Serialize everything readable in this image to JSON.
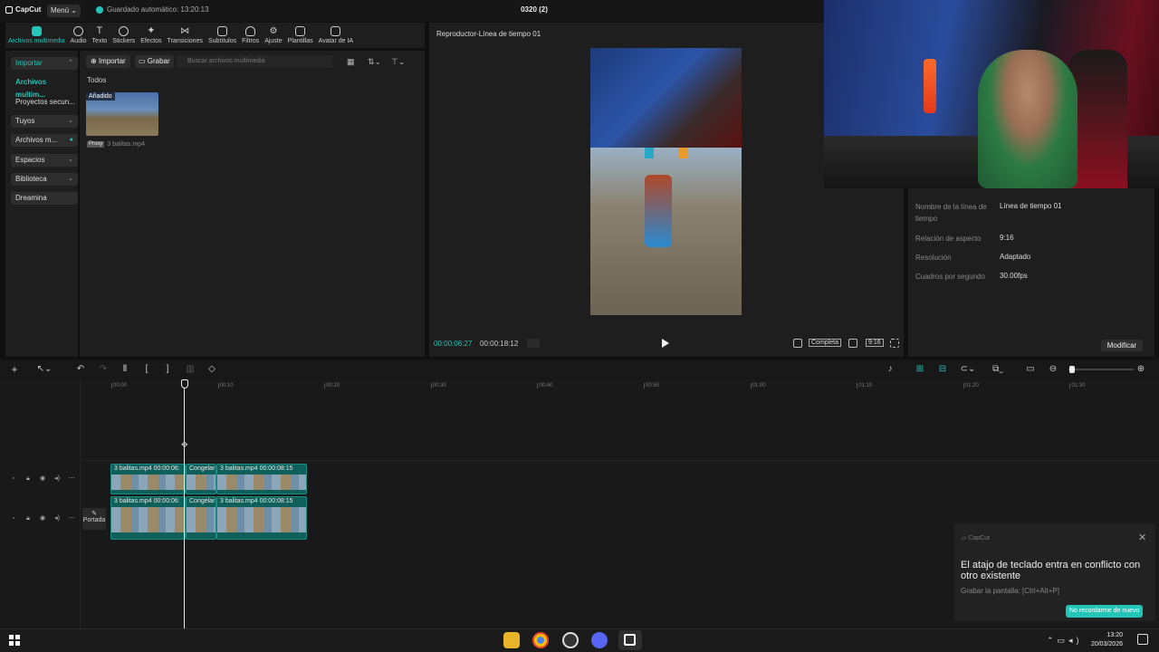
{
  "app": {
    "logo": "CapCut",
    "menu_label": "Menú ⌄",
    "autosave": "Guardado automático: 13:20:13",
    "project_title": "0320 (2)"
  },
  "tabs": [
    {
      "label": "Archivos multimedia",
      "icon": "media-icon",
      "active": true
    },
    {
      "label": "Audio",
      "icon": "audio-icon"
    },
    {
      "label": "Texto",
      "icon": "text-icon"
    },
    {
      "label": "Stickers",
      "icon": "sticker-icon"
    },
    {
      "label": "Efectos",
      "icon": "effects-icon"
    },
    {
      "label": "Transiciones",
      "icon": "transitions-icon"
    },
    {
      "label": "Subtítulos",
      "icon": "subtitles-icon"
    },
    {
      "label": "Filtros",
      "icon": "filters-icon"
    },
    {
      "label": "Ajuste",
      "icon": "adjust-icon"
    },
    {
      "label": "Plantillas",
      "icon": "templates-icon"
    },
    {
      "label": "Avatar de IA",
      "icon": "ai-avatar-icon"
    }
  ],
  "sidebar": {
    "items": [
      {
        "label": "Importar"
      },
      {
        "label": "Archivos multim..."
      },
      {
        "label": "Proyectos secun..."
      },
      {
        "label": "Tuyos"
      },
      {
        "label": "Archivos m..."
      },
      {
        "label": "Espacios"
      },
      {
        "label": "Biblioteca"
      },
      {
        "label": "Dreamina"
      }
    ]
  },
  "media": {
    "import_label": "Importar",
    "record_label": "Grabar",
    "search_placeholder": "Buscar archivos multimedia",
    "section_label": "Todos",
    "item": {
      "badge": "Añadido",
      "proxy": "Proxy",
      "name": "3 balitas.mp4"
    }
  },
  "player": {
    "title": "Reproductor-Línea de tiempo 01",
    "current_time": "00:00:06:27",
    "total_time": "00:00:18:12",
    "complete_label": "Completa",
    "ratio_label": "9:16"
  },
  "details": {
    "rows": [
      {
        "key": "Nombre de la línea de tiempo",
        "value": "Línea de tiempo 01"
      },
      {
        "key": "Relación de aspecto",
        "value": "9:16"
      },
      {
        "key": "Resolución",
        "value": "Adaptado"
      },
      {
        "key": "Cuadros por segundo",
        "value": "30.00fps"
      }
    ],
    "modify_label": "Modificar"
  },
  "timeline": {
    "ruler": [
      "00:00",
      "00:10",
      "00:20",
      "00:30",
      "00:40",
      "00:50",
      "01:00",
      "01:10",
      "01:20",
      "01:30"
    ],
    "cover_label": "Portada",
    "tracks": [
      {
        "clips": [
          {
            "label": "3 balitas.mp4   00:00:06:"
          },
          {
            "label": "Congelar"
          },
          {
            "label": "3 balitas.mp4   00:00:08:15"
          }
        ]
      },
      {
        "clips": [
          {
            "label": "3 balitas.mp4   00:00:06:"
          },
          {
            "label": "Congelar"
          },
          {
            "label": "3 balitas.mp4   00:00:08:15"
          }
        ]
      }
    ]
  },
  "notification": {
    "brand": "CapCut",
    "title": "El atajo de teclado entra en conflicto con otro existente",
    "subtitle": "Grabar la pantalla: [Ctrl+Alt+P]",
    "button": "No recordarme de nuevo"
  },
  "taskbar": {
    "time": "13:20",
    "date": "20/03/2026"
  },
  "colors": {
    "accent": "#22c5b8",
    "clip": "#0f5f5a"
  }
}
